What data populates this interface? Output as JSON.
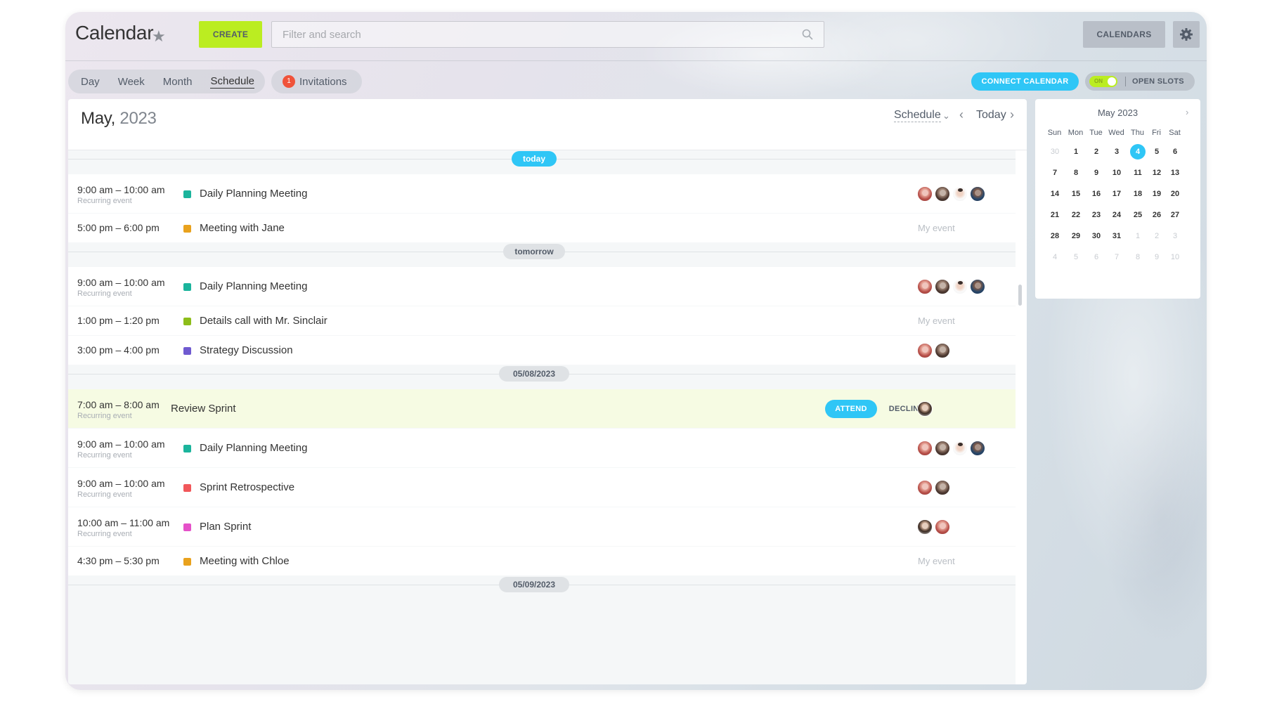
{
  "header": {
    "title": "Calendar",
    "create_label": "CREATE",
    "search_placeholder": "Filter and search",
    "calendars_label": "CALENDARS"
  },
  "nav": {
    "views": [
      "Day",
      "Week",
      "Month",
      "Schedule"
    ],
    "active_view": "Schedule",
    "invitations_count": "1",
    "invitations_label": "Invitations",
    "connect_label": "CONNECT CALENDAR",
    "toggle_label": "ON",
    "open_slots_label": "OPEN SLOTS"
  },
  "main": {
    "month": "May,",
    "year": "2023",
    "view_select": "Schedule",
    "today_label": "Today"
  },
  "colors": {
    "accent": "#2fc6f6",
    "create": "#bbed21",
    "badge": "#f0533a",
    "highlight_row": "#f6fbe3"
  },
  "days": [
    {
      "label": "today",
      "events": [
        {
          "time": "9:00 am – 10:00 am",
          "sub": "Recurring event",
          "title": "Daily Planning Meeting",
          "color": "#1bb49c",
          "attendees": [
            "av1",
            "av2",
            "av3",
            "av4"
          ]
        },
        {
          "time": "5:00 pm – 6:00 pm",
          "sub": "",
          "title": "Meeting with Jane",
          "color": "#e9a21d",
          "note": "My event"
        }
      ]
    },
    {
      "label": "tomorrow",
      "events": [
        {
          "time": "9:00 am – 10:00 am",
          "sub": "Recurring event",
          "title": "Daily Planning Meeting",
          "color": "#1bb49c",
          "attendees": [
            "av1",
            "av2",
            "av3",
            "av4"
          ]
        },
        {
          "time": "1:00 pm – 1:20 pm",
          "sub": "",
          "title": "Details call with Mr. Sinclair",
          "color": "#8dbd1a",
          "note": "My event"
        },
        {
          "time": "3:00 pm – 4:00 pm",
          "sub": "",
          "title": "Strategy Discussion",
          "color": "#6f5ad0",
          "attendees": [
            "av1",
            "av2"
          ]
        }
      ]
    },
    {
      "label": "05/08/2023",
      "events": [
        {
          "time": "7:00 am – 8:00 am",
          "sub": "Recurring event",
          "title": "Review Sprint",
          "invite": true,
          "attend_label": "ATTEND",
          "decline_label": "DECLINE",
          "attendees": [
            "av5"
          ]
        },
        {
          "time": "9:00 am – 10:00 am",
          "sub": "Recurring event",
          "title": "Daily Planning Meeting",
          "color": "#1bb49c",
          "attendees": [
            "av1",
            "av2",
            "av3",
            "av4"
          ]
        },
        {
          "time": "9:00 am – 10:00 am",
          "sub": "Recurring event",
          "title": "Sprint Retrospective",
          "color": "#f1575a",
          "attendees": [
            "av1",
            "av2"
          ]
        },
        {
          "time": "10:00 am – 11:00 am",
          "sub": "Recurring event",
          "title": "Plan Sprint",
          "color": "#e551c9",
          "attendees": [
            "av5",
            "av1"
          ]
        },
        {
          "time": "4:30 pm – 5:30 pm",
          "sub": "",
          "title": "Meeting with Chloe",
          "color": "#e9a21d",
          "note": "My event"
        }
      ]
    },
    {
      "label": "05/09/2023",
      "events": []
    }
  ],
  "mini_calendar": {
    "title": "May 2023",
    "weekdays": [
      "Sun",
      "Mon",
      "Tue",
      "Wed",
      "Thu",
      "Fri",
      "Sat"
    ],
    "weeks": [
      [
        "30",
        "1",
        "2",
        "3",
        "4",
        "5",
        "6"
      ],
      [
        "7",
        "8",
        "9",
        "10",
        "11",
        "12",
        "13"
      ],
      [
        "14",
        "15",
        "16",
        "17",
        "18",
        "19",
        "20"
      ],
      [
        "21",
        "22",
        "23",
        "24",
        "25",
        "26",
        "27"
      ],
      [
        "28",
        "29",
        "30",
        "31",
        "1",
        "2",
        "3"
      ],
      [
        "4",
        "5",
        "6",
        "7",
        "8",
        "9",
        "10"
      ]
    ],
    "selected": "4"
  }
}
